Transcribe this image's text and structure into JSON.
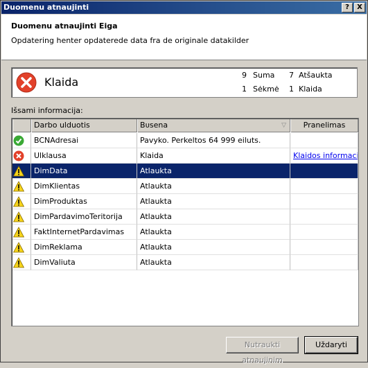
{
  "window": {
    "title": "Duomenu atnaujinti",
    "help_label": "?",
    "close_label": "X"
  },
  "header": {
    "title": "Duomenu atnaujinti Eiga",
    "subtitle": "Opdatering henter opdaterede data fra de originale datakilder"
  },
  "status": {
    "label": "Klaida",
    "total_count": "9",
    "total_label": "Suma",
    "success_count": "1",
    "success_label": "Sėkmė",
    "cancelled_count": "7",
    "cancelled_label": "Atšaukta",
    "error_count": "1",
    "error_label": "Klaida"
  },
  "details_label": "Išsami informacija:",
  "table": {
    "columns": [
      "Darbo ulduotis",
      "Bᴜsena",
      "Pranelimas"
    ],
    "rows": [
      {
        "icon": "success-icon",
        "task": "BCNAdresai",
        "status": "Pavyko. Perkeltos 64 999 eiluts.",
        "message": ""
      },
      {
        "icon": "error-icon",
        "task": "Ulklausa",
        "status": "Klaida",
        "message": "Klaidos informacija:"
      },
      {
        "icon": "warning-icon",
        "task": "DimData",
        "status": "Atlaukta",
        "message": ""
      },
      {
        "icon": "warning-icon",
        "task": "DimKlientas",
        "status": "Atlaukta",
        "message": ""
      },
      {
        "icon": "warning-icon",
        "task": "DimProduktas",
        "status": "Atlaukta",
        "message": ""
      },
      {
        "icon": "warning-icon",
        "task": "DimPardavimoTeritorija",
        "status": "Atlaukta",
        "message": ""
      },
      {
        "icon": "warning-icon",
        "task": "FaktInternetPardavimas",
        "status": "Atlaukta",
        "message": ""
      },
      {
        "icon": "warning-icon",
        "task": "DimReklama",
        "status": "Atlaukta",
        "message": ""
      },
      {
        "icon": "warning-icon",
        "task": "DimValiuta",
        "status": "Atlaukta",
        "message": ""
      }
    ]
  },
  "buttons": {
    "stop_label": "Nutraukti atnaujinim",
    "close_label": "Uždaryti"
  },
  "colors": {
    "selection": "#0a246a",
    "error": "#e2412a",
    "success": "#3aa935",
    "warning": "#f5d31a"
  }
}
